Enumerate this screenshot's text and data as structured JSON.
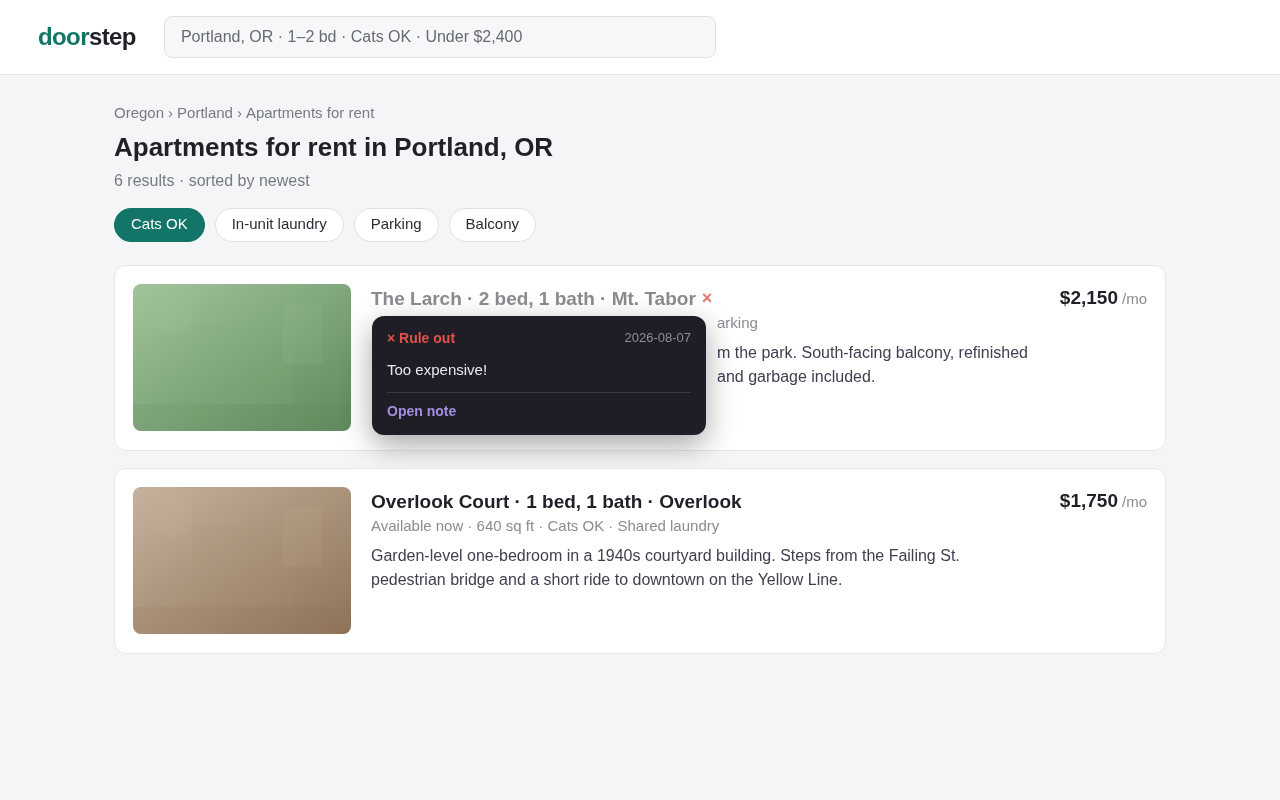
{
  "header": {
    "logo": {
      "first": "door",
      "second": "step"
    },
    "search": {
      "value": "Portland, OR · 1–2 bd · Cats OK · Under $2,400"
    }
  },
  "breadcrumb": [
    "Oregon",
    "Portland",
    "Apartments for rent"
  ],
  "breadcrumb_separator": "›",
  "title": "Apartments for rent in Portland, OR",
  "summary": "6 results · sorted by newest",
  "filters": [
    {
      "label": "Cats OK",
      "selected": true
    },
    {
      "label": "In-unit laundry",
      "selected": false
    },
    {
      "label": "Parking",
      "selected": false
    },
    {
      "label": "Balcony",
      "selected": false
    }
  ],
  "listings": [
    {
      "title": "The Larch · 2 bed, 1 bath · Mt. Tabor",
      "ruled_out": true,
      "ruled_mark": "×",
      "price": "$2,150",
      "per": "/mo",
      "details": "arking",
      "description": [
        "m the park. South-facing balcony, refinished",
        "and garbage included."
      ],
      "note": {
        "label": "× Rule out",
        "date": "2026-08-07",
        "text": "Too expensive!",
        "link": "Open note"
      }
    },
    {
      "title": "Overlook Court · 1 bed, 1 bath · Overlook",
      "ruled_out": false,
      "price": "$1,750",
      "per": "/mo",
      "details": "Available now · 640 sq ft · Cats OK · Shared laundry",
      "description": [
        "Garden-level one-bedroom in a 1940s courtyard building. Steps from the Failing St.",
        "pedestrian bridge and a short ride to downtown on the Yellow Line."
      ]
    }
  ]
}
